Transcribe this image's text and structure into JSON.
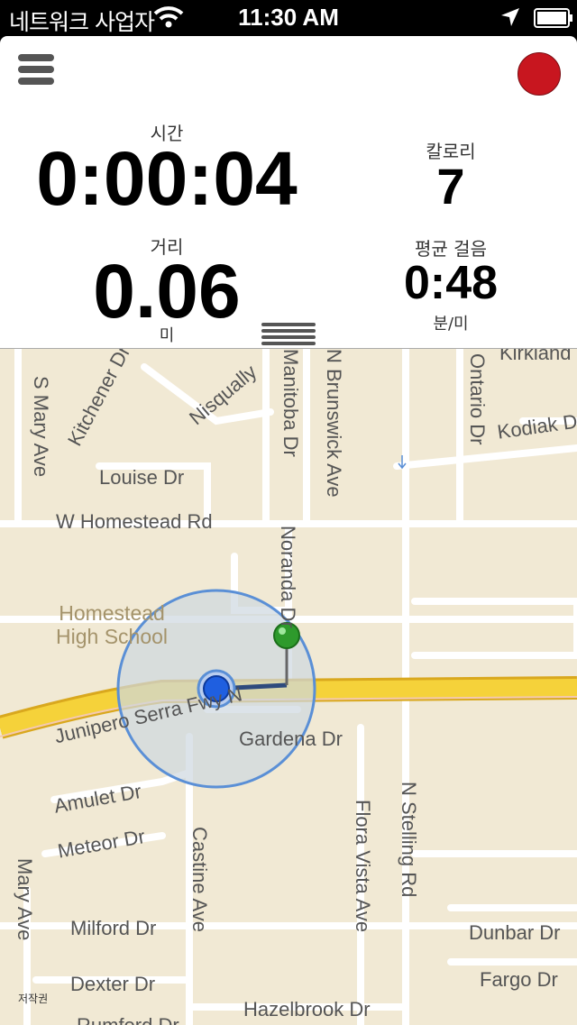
{
  "status_bar": {
    "carrier": "네트워크 사업자",
    "time": "11:30 AM"
  },
  "stats": {
    "time_label": "시간",
    "time_value": "0:00:04",
    "calories_label": "칼로리",
    "calories_value": "7",
    "distance_label": "거리",
    "distance_value": "0.06",
    "distance_unit": "미",
    "pace_label": "평균 걸음",
    "pace_value": "0:48",
    "pace_unit": "분/미"
  },
  "map": {
    "streets": {
      "s_mary_ave": "S Mary Ave",
      "kitchener_dr": "Kitchener Dr",
      "nisqually": "Nisqually",
      "manitoba_dr": "Manitoba Dr",
      "n_brunswick_ave": "N Brunswick Ave",
      "ontario_dr": "Ontario Dr",
      "kirkland": "Kirkland",
      "kodiak_dr": "Kodiak Dr",
      "louise_dr": "Louise Dr",
      "w_homestead_rd": "W Homestead Rd",
      "noranda_dr": "Noranda Dr",
      "junipero_serra": "Junipero Serra Fwy N",
      "gardena_dr": "Gardena Dr",
      "amulet_dr": "Amulet Dr",
      "meteor_dr": "Meteor Dr",
      "flora_vista_ave": "Flora Vista Ave",
      "n_stelling_rd": "N Stelling Rd",
      "castine_ave": "Castine Ave",
      "mary_ave": "Mary Ave",
      "milford_dr": "Milford Dr",
      "dunbar_dr": "Dunbar Dr",
      "fargo_dr": "Fargo Dr",
      "dexter_dr": "Dexter Dr",
      "hazelbrook_dr": "Hazelbrook Dr",
      "rumford_dr": "Rumford Dr"
    },
    "poi": {
      "school_line1": "Homestead",
      "school_line2": "High School"
    },
    "copyright": "저작권"
  },
  "colors": {
    "record": "#c8161f",
    "map_bg": "#f1e9d4",
    "freeway": "#f5d23a",
    "accuracy": "#5a8fd6",
    "pin": "#2e9a2c"
  }
}
